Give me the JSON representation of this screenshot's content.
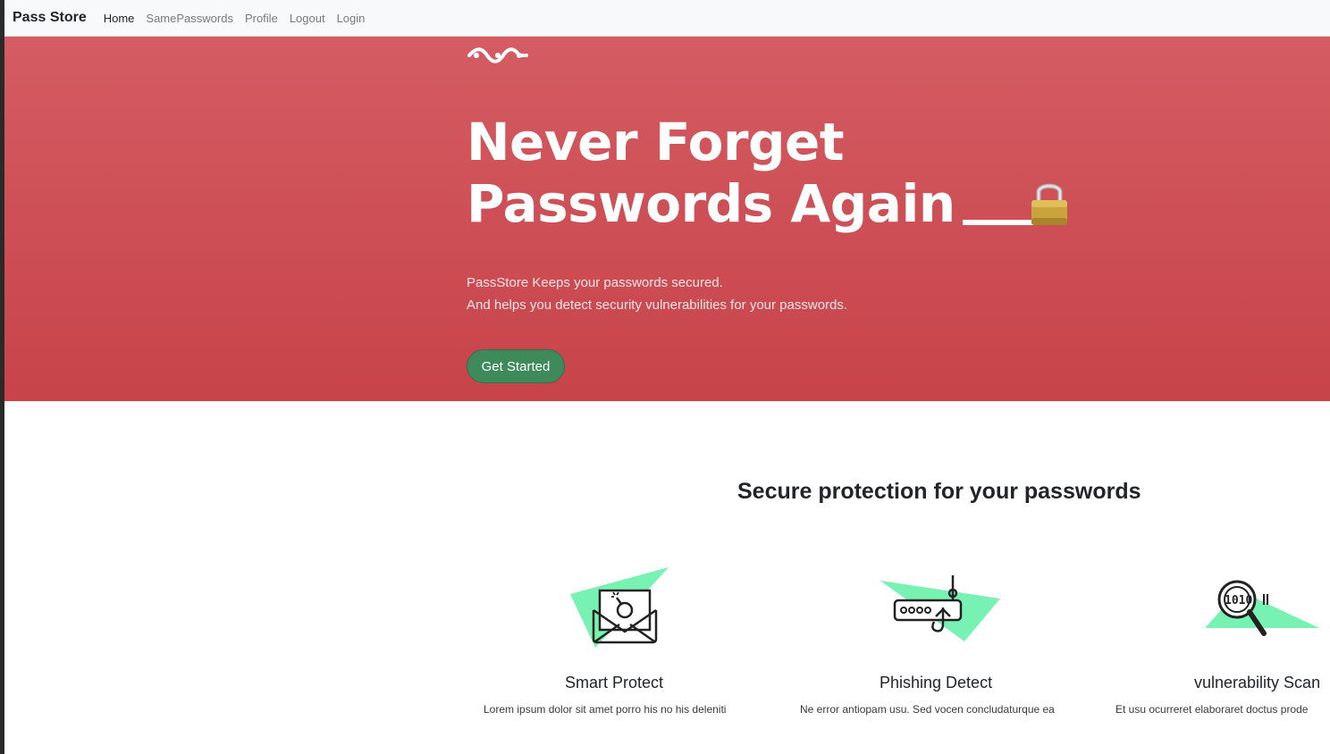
{
  "navbar": {
    "brand": "Pass Store",
    "links": [
      {
        "label": "Home"
      },
      {
        "label": "SamePasswords"
      },
      {
        "label": "Profile"
      },
      {
        "label": "Logout"
      },
      {
        "label": "Login"
      }
    ]
  },
  "hero": {
    "logo_icon": "wave-chain-logo",
    "title_line1": "Never Forget",
    "title_line2": "Passwords Again",
    "title_icon": "padlock-icon",
    "subtitle_line1": "PassStore Keeps your passwords secured.",
    "subtitle_line2": "And helps you detect security vulnerabilities for your passwords.",
    "cta_label": "Get Started",
    "colors": {
      "background_top": "#d45c62",
      "background_bottom": "#c8434a",
      "cta": "#3f8a5b"
    }
  },
  "section": {
    "title": "Secure protection for your passwords"
  },
  "features": [
    {
      "icon": "envelope-bomb-icon",
      "title": "Smart Protect",
      "desc": "Lorem ipsum dolor sit amet porro his no his deleniti"
    },
    {
      "icon": "router-hook-icon",
      "title": "Phishing Detect",
      "desc": "Ne error antiopam usu. Sed vocen concludaturque ea"
    },
    {
      "icon": "magnifier-binary-icon",
      "title": "vulnerability Scan",
      "desc": "Et usu ocurreret elaboraret doctus prode"
    }
  ],
  "accent_color": "#78f2b2"
}
